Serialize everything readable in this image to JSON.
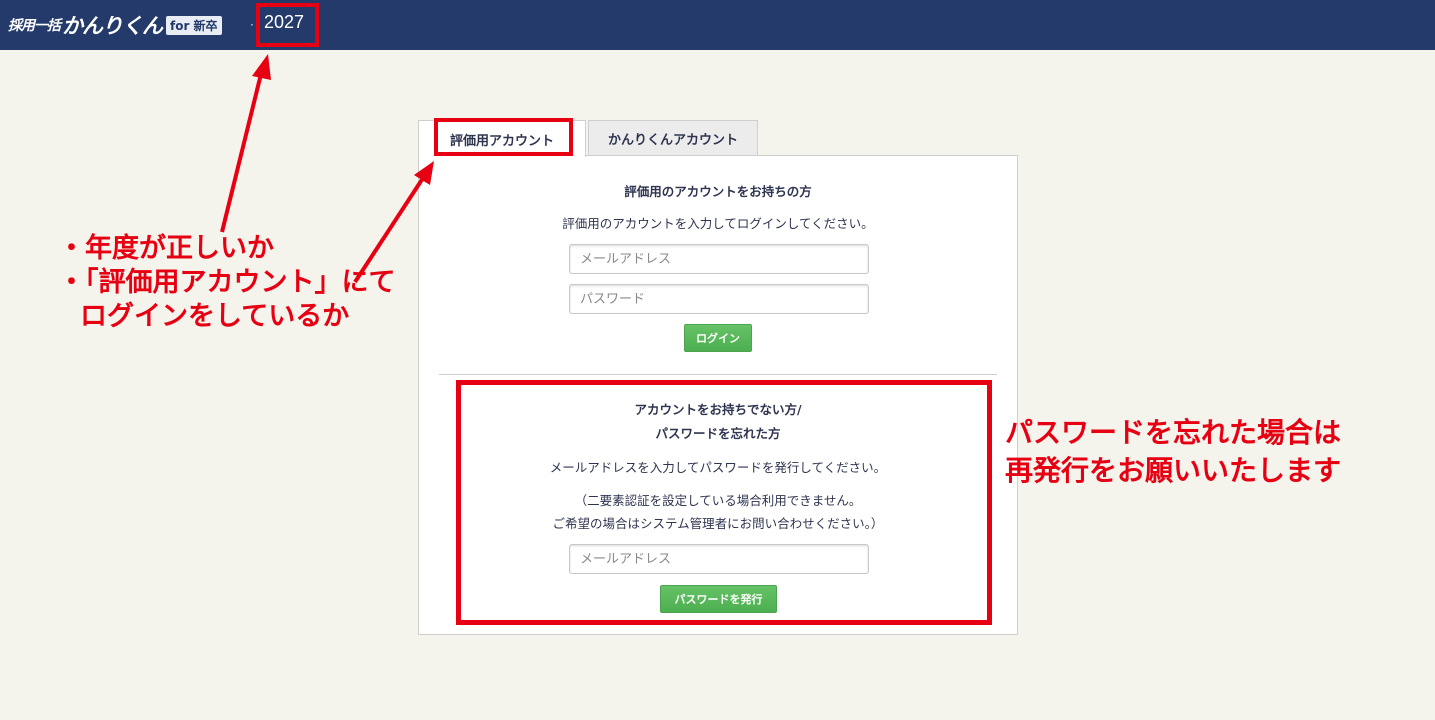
{
  "header": {
    "logo_small": "採用一括",
    "logo_big": "かんりくん",
    "logo_badge": "for 新卒",
    "separator": "·",
    "year": "2027"
  },
  "tabs": [
    {
      "label": "評価用アカウント",
      "active": true
    },
    {
      "label": "かんりくんアカウント",
      "active": false
    }
  ],
  "login": {
    "title": "評価用のアカウントをお持ちの方",
    "instruction": "評価用のアカウントを入力してログインしてください。",
    "email_placeholder": "メールアドレス",
    "password_placeholder": "パスワード",
    "button_label": "ログイン"
  },
  "reset": {
    "title_line1": "アカウントをお持ちでない方/",
    "title_line2": "パスワードを忘れた方",
    "instruction": "メールアドレスを入力してパスワードを発行してください。",
    "note_line1": "（二要素認証を設定している場合利用できません。",
    "note_line2": "ご希望の場合はシステム管理者にお問い合わせください。）",
    "email_placeholder": "メールアドレス",
    "button_label": "パスワードを発行"
  },
  "annotations": {
    "left_line1": "・年度が正しいか",
    "left_line2": "・「評価用アカウント」にて",
    "left_line3": "ログインをしているか",
    "right_line1": "パスワードを忘れた場合は",
    "right_line2": "再発行をお願いいたします"
  },
  "colors": {
    "header_bg": "#233a6b",
    "highlight": "#e60012",
    "button_green": "#4caf50",
    "page_bg": "#f4f3ec"
  }
}
